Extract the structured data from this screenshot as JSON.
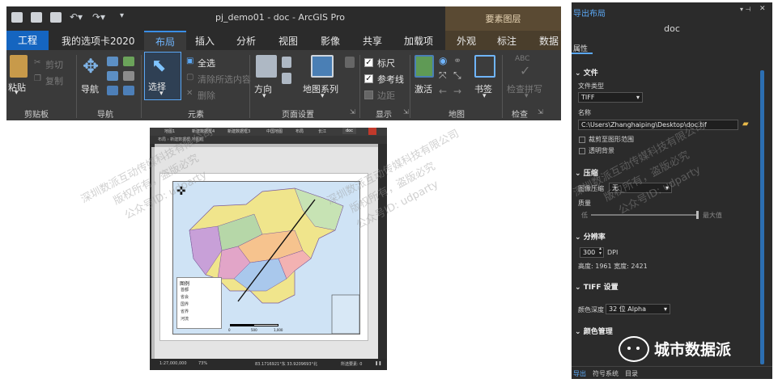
{
  "ribbon": {
    "window_title": "pj_demo01 - doc - ArcGIS Pro",
    "context_header": "要素图层",
    "tabs": [
      "工程",
      "我的选项卡2020",
      "布局",
      "插入",
      "分析",
      "视图",
      "影像",
      "共享",
      "加载项",
      "外观",
      "标注",
      "数据"
    ],
    "active_tab": "布局",
    "groups": {
      "clipboard": {
        "label": "剪贴板",
        "paste": "粘贴",
        "cut": "剪切",
        "copy": "复制"
      },
      "navigate": {
        "label": "导航",
        "nav": "导航"
      },
      "elements": {
        "label": "元素",
        "select": "选择",
        "select_all": "全选",
        "clear_selection": "清除所选内容",
        "delete": "删除"
      },
      "page_setup": {
        "label": "页面设置",
        "orientation": "方向",
        "map_series": "地图系列"
      },
      "show": {
        "label": "显示",
        "ruler": "标尺",
        "guides": "参考线",
        "margins": "边距",
        "ruler_checked": true,
        "guides_checked": true,
        "margins_checked": false
      },
      "map": {
        "label": "地图",
        "activate": "激活",
        "bookmarks": "书签"
      },
      "review": {
        "label": "检查",
        "check_spelling": "检查拼写"
      }
    }
  },
  "map_app": {
    "tabs": [
      "地图1",
      "新建数据框4",
      "新建数据框3",
      "中国地图",
      "布局",
      "长江",
      "doc"
    ],
    "toolbar_path": "布局 › 新建数据框 地图框",
    "legend_title": "图例",
    "legend_items": [
      "首都",
      "省会",
      "国界",
      "省界",
      "河流"
    ],
    "scale_labels": [
      "0",
      "500",
      "1,000"
    ],
    "status": {
      "scale": "1:27,000,000",
      "zoom": "73%",
      "coords": "83.1716921°东 33.9209693°北",
      "selected": "所选要素: 0"
    }
  },
  "export_pane": {
    "title": "导出布局",
    "doc_name": "doc",
    "props_tab": "属性",
    "file": {
      "section": "文件",
      "type_label": "文件类型",
      "type_value": "TIFF",
      "name_label": "名称",
      "name_value": "C:\\Users\\Zhanghaiping\\Desktop\\doc.tif",
      "clip_label": "裁剪至图形范围",
      "transparent_label": "透明背景"
    },
    "compression": {
      "section": "压缩",
      "image_label": "图像压缩",
      "image_value": "无",
      "quality_label": "质量",
      "low": "低",
      "max": "最大值"
    },
    "resolution": {
      "section": "分辨率",
      "dpi_value": "300",
      "dpi_unit": "DPI",
      "size_text": "高度: 1961 宽度: 2421"
    },
    "tiff": {
      "section": "TIFF 设置",
      "depth_label": "颜色深度",
      "depth_value": "32 位 Alpha"
    },
    "color": {
      "section": "颜色管理"
    },
    "bottom_tabs": [
      "导出",
      "符号系统",
      "目录"
    ]
  },
  "watermark": {
    "line1": "深圳数派互动传媒科技有限公司",
    "line2": "版权所有，盗版必究",
    "line3": "公众号ID: udparty"
  },
  "brand": {
    "text": "城市数据派"
  }
}
